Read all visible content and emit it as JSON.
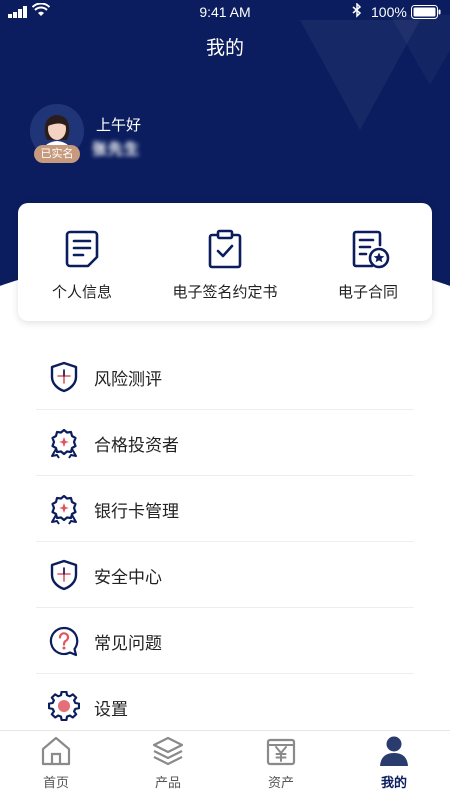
{
  "status_bar": {
    "time": "9:41 AM",
    "battery": "100%"
  },
  "header": {
    "title": "我的",
    "greeting": "上午好",
    "username": "张先生",
    "verified_badge": "已实名"
  },
  "quick_card": {
    "items": [
      {
        "label": "个人信息",
        "icon": "document-icon"
      },
      {
        "label": "电子签名约定书",
        "icon": "clipboard-check-icon"
      },
      {
        "label": "电子合同",
        "icon": "contract-star-icon"
      }
    ]
  },
  "menu": {
    "items": [
      {
        "label": "风险测评",
        "icon": "shield-icon"
      },
      {
        "label": "合格投资者",
        "icon": "medal-icon"
      },
      {
        "label": "银行卡管理",
        "icon": "medal-icon"
      },
      {
        "label": "安全中心",
        "icon": "shield-icon"
      },
      {
        "label": "常见问题",
        "icon": "question-bubble-icon"
      },
      {
        "label": "设置",
        "icon": "gear-icon"
      }
    ]
  },
  "tabbar": {
    "tabs": [
      {
        "label": "首页",
        "icon": "home-icon"
      },
      {
        "label": "产品",
        "icon": "layers-icon"
      },
      {
        "label": "资产",
        "icon": "yen-box-icon"
      },
      {
        "label": "我的",
        "icon": "person-icon",
        "active": true
      }
    ]
  },
  "colors": {
    "primary": "#0b1d5e",
    "accent": "#e05561",
    "badge": "#c79a7e"
  }
}
